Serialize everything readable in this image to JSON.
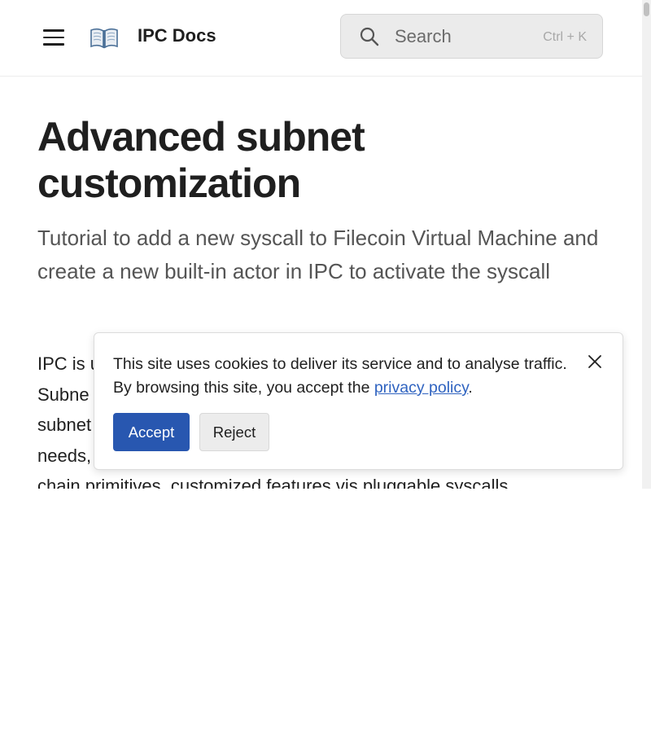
{
  "header": {
    "site_title": "IPC Docs",
    "menu_icon": "hamburger-menu-icon",
    "logo_icon": "open-book-icon",
    "search": {
      "placeholder": "Search",
      "shortcut": "Ctrl + K",
      "icon": "search-icon"
    }
  },
  "main": {
    "title": "Advanced subnet customization",
    "subtitle": "Tutorial to add a new syscall to Filecoin Virtual Machine and create a new built-in actor in IPC to activate the syscall",
    "body_lines": [
      "IPC is u",
      "Subne",
      "subnet",
      "needs,",
      "chain primitives, customized features vis pluggable syscalls"
    ]
  },
  "cookie_banner": {
    "text_before": "This site uses cookies to deliver its service and to analyse traffic. By browsing this site, you accept the ",
    "link_text": "privacy policy",
    "text_after": ".",
    "accept_label": "Accept",
    "reject_label": "Reject",
    "close_icon": "close-icon"
  },
  "colors": {
    "accent": "#2857b0",
    "link": "#2f63c0",
    "search_bg": "#ebebeb"
  }
}
